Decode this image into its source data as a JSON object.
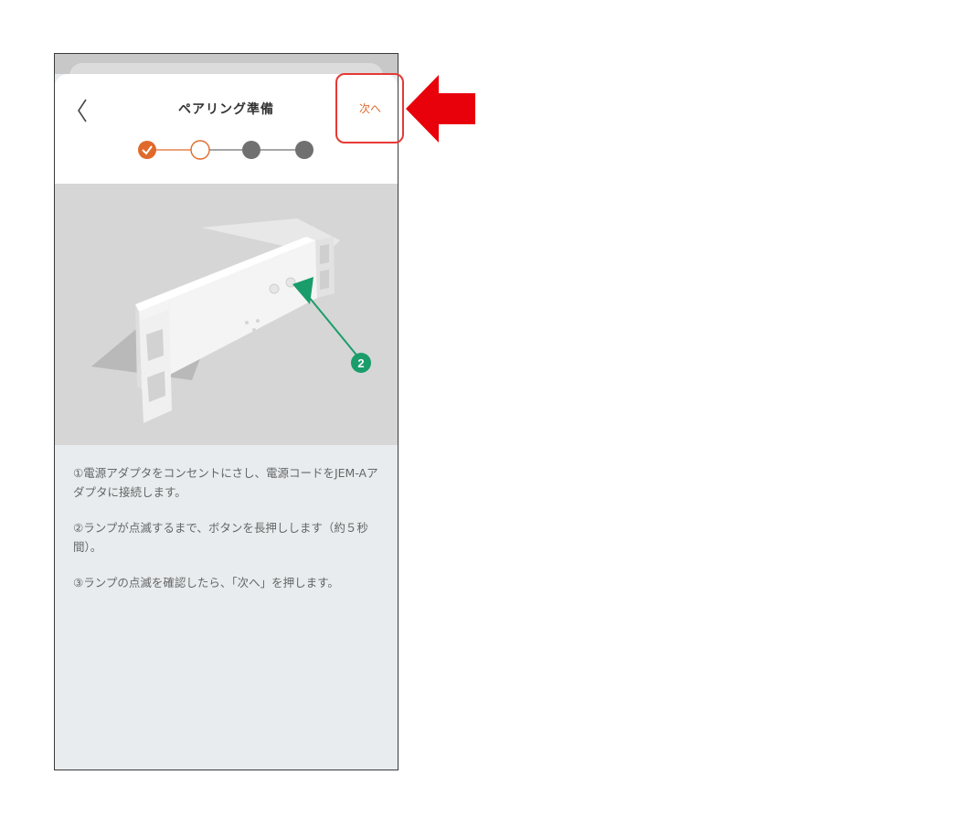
{
  "header": {
    "title": "ペアリング準備",
    "next_label": "次へ"
  },
  "stepper": {
    "steps": [
      {
        "state": "completed"
      },
      {
        "state": "current"
      },
      {
        "state": "upcoming"
      },
      {
        "state": "upcoming"
      }
    ],
    "accent_color": "#e06a2c",
    "inactive_color": "#707070"
  },
  "illustration": {
    "callout_number": "2",
    "callout_color": "#1a9d6b"
  },
  "instructions": {
    "step1": "①電源アダプタをコンセントにさし、電源コードをJEM-Aアダプタに接続します。",
    "step2": "②ランプが点滅するまで、ボタンを長押しします（約５秒間）。",
    "step3": "③ランプの点滅を確認したら、「次へ」を押します。"
  },
  "annotation": {
    "highlight_color": "#e53935",
    "arrow_color": "#e8000b"
  }
}
